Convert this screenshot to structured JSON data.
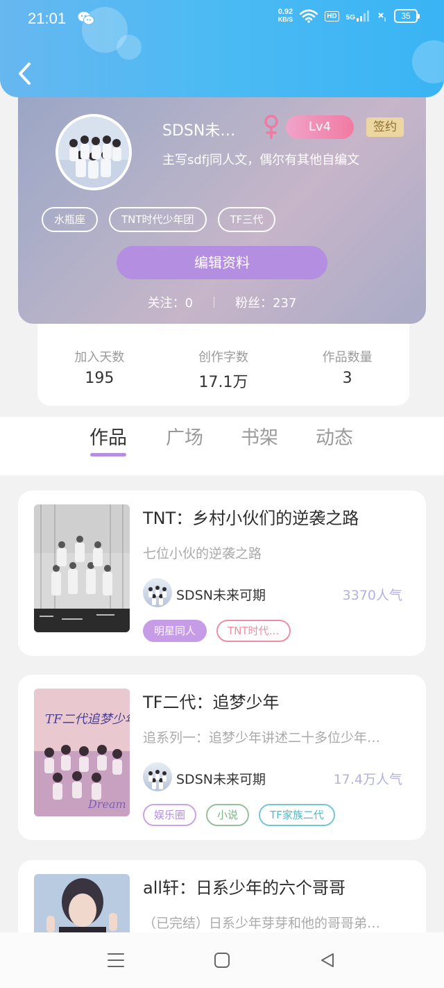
{
  "status_bar": {
    "time": "21:01",
    "speed_value": "0.92",
    "speed_unit": "KB/S",
    "hd_label": "HD",
    "network_label": "5G",
    "battery": "35"
  },
  "profile": {
    "nickname": "SDSN未…",
    "level": "Lv4",
    "signed": "签约",
    "bio": "主写sdfj同人文，偶尔有其他自编文",
    "tags": [
      "水瓶座",
      "TNT时代少年团",
      "TF三代"
    ],
    "edit_label": "编辑资料",
    "follow_label": "关注：0",
    "fans_label": "粉丝：237"
  },
  "stats": [
    {
      "label": "加入天数",
      "value": "195"
    },
    {
      "label": "创作字数",
      "value": "17.1万"
    },
    {
      "label": "作品数量",
      "value": "3"
    }
  ],
  "tabs": [
    "作品",
    "广场",
    "书架",
    "动态"
  ],
  "works": [
    {
      "title": "TNT：乡村小伙们的逆袭之路",
      "desc": "七位小伙的逆袭之路",
      "author": "SDSN未来可期",
      "popularity": "3370人气",
      "tags": [
        {
          "label": "明星同人",
          "style": "filled",
          "color": "#c79ce6"
        },
        {
          "label": "TNT时代…",
          "style": "outline",
          "color": "#ee8ea3"
        }
      ]
    },
    {
      "title": "TF二代：追梦少年",
      "desc": "追系列一：追梦少年讲述二十多位少年…",
      "author": "SDSN未来可期",
      "popularity": "17.4万人气",
      "cover_text": "TF二代追梦少年",
      "cover_sub": "Dream",
      "tags": [
        {
          "label": "娱乐圈",
          "style": "outline",
          "color": "#c9a3e6"
        },
        {
          "label": "小说",
          "style": "outline",
          "color": "#94c09a"
        },
        {
          "label": "TF家族二代",
          "style": "outline",
          "color": "#73c7d5"
        }
      ]
    },
    {
      "title": "all轩：日系少年的六个哥哥",
      "desc": "（已完结）日系少年芽芽和他的哥哥弟…"
    }
  ]
}
